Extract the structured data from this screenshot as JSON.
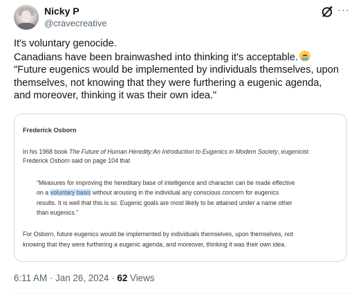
{
  "author": {
    "name": "Nicky P",
    "handle": "@cravecreative"
  },
  "tweet": {
    "lines": [
      "It's voluntary genocide.",
      "Canadians have been brainwashed into thinking it's acceptable.",
      "\"Future eugenics would be implemented by individuals themselves, upon",
      "themselves, not knowing that they were furthering a eugenic agenda,",
      "and moreover, thinking it was their own idea.\""
    ],
    "emoji": "loudly-crying-face-emoji"
  },
  "card": {
    "title": "Frederick Osborn",
    "intro": {
      "line1_prefix": "In his 1968 book ",
      "line1_book": "The Future of Human Heredity:An Introduction to Eugenics in Modern Society",
      "line1_suffix": ", eugenicist",
      "line2": "Frederick Osborn said on page 104 that"
    },
    "quote": {
      "line1": "“Measures for improving the hereditary base of intelligence and character can be made effective",
      "line2_prefix": "on a ",
      "line2_highlight": "voluntary basis",
      "line2_suffix": " without arousing in the individual any conscious concern for eugenics",
      "line3": "results.  It is well that this is so.  Eugenic goals are most likely to be attained under a name other",
      "line4": "than eugenics.”"
    },
    "conclusion": {
      "line1": "For Osborn, future eugenics would be implemented by individuals themselves, upon themselves, not",
      "line2": "knowing that they were furthering a eugenic agenda, and moreover, thinking it was their own idea."
    }
  },
  "meta": {
    "time": "6:11 AM",
    "separator": " · ",
    "date": "Jan 26, 2024",
    "views_count": "62",
    "views_label": " Views"
  }
}
